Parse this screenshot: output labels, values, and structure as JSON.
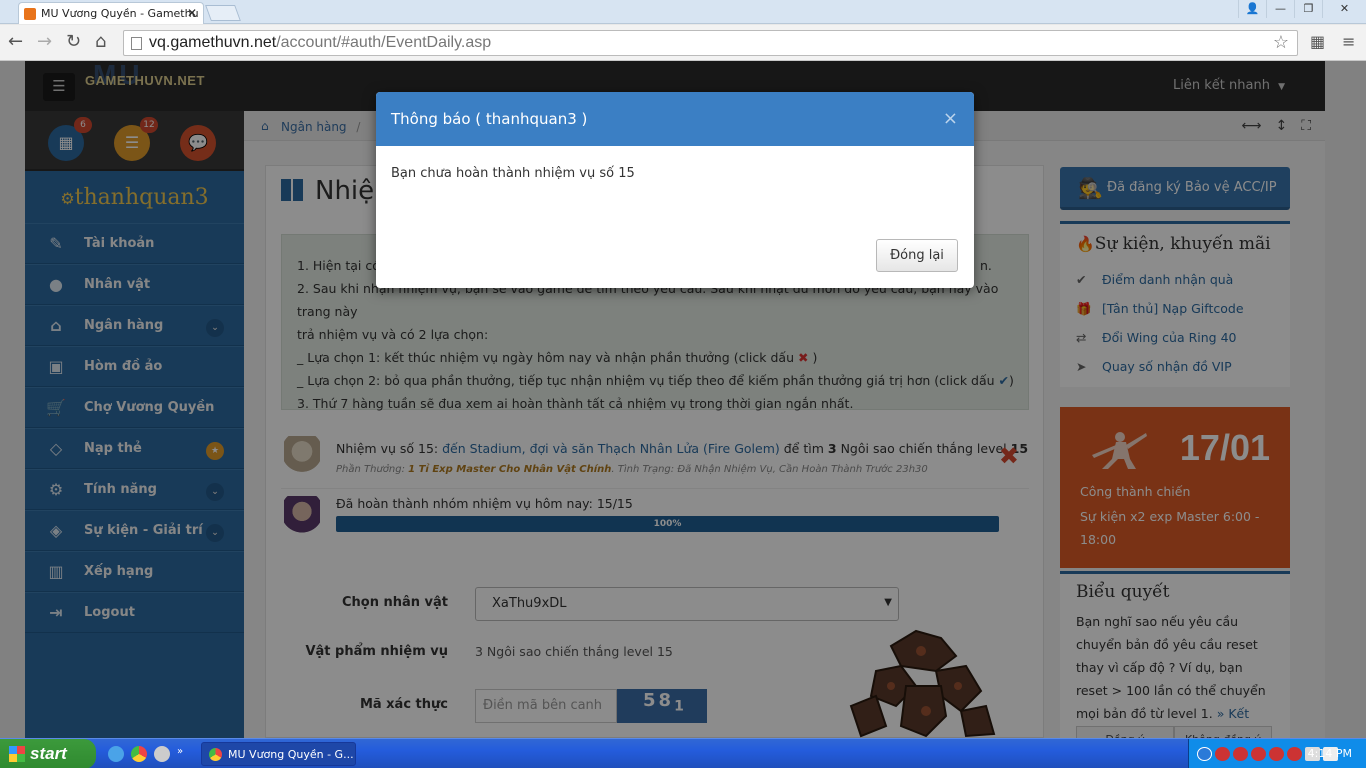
{
  "browser": {
    "tab_title": "MU Vương Quyền - Gamethu",
    "tab_close": "✕",
    "url_host": "vq.gamethuvn.net",
    "url_path": "/account/#auth/EventDaily.asp"
  },
  "site": {
    "logo_text": "GAMETHUVN.NET",
    "logo_mu": "MU",
    "quick_links": "Liên kết nhanh"
  },
  "sidebar": {
    "badges": {
      "calendar": "6",
      "list": "12"
    },
    "username": "thanhquan3",
    "items": [
      {
        "label": "Tài khoản",
        "icon": "edit-icon",
        "glyph": "✎"
      },
      {
        "label": "Nhân vật",
        "icon": "user-icon",
        "glyph": "●"
      },
      {
        "label": "Ngân hàng",
        "icon": "bank-icon",
        "glyph": "⌂"
      },
      {
        "label": "Hòm đồ ảo",
        "icon": "briefcase-icon",
        "glyph": "▣"
      },
      {
        "label": "Chợ Vương Quyền",
        "icon": "cart-icon",
        "glyph": "🛒"
      },
      {
        "label": "Nạp thẻ",
        "icon": "diamond-icon",
        "glyph": "◇"
      },
      {
        "label": "Tính năng",
        "icon": "cogs-icon",
        "glyph": "⚙"
      },
      {
        "label": "Sự kiện - Giải trí",
        "icon": "tag-icon",
        "glyph": "◈"
      },
      {
        "label": "Xếp hạng",
        "icon": "chart-icon",
        "glyph": "▥"
      },
      {
        "label": "Logout",
        "icon": "logout-icon",
        "glyph": "⇥"
      }
    ]
  },
  "breadcrumb": {
    "home": "Ngân hàng",
    "sep": "/"
  },
  "page": {
    "title": "Nhiệm",
    "info": {
      "line1": "1. Hiện tại có",
      "line1_end": "n.",
      "line2": "2. Sau khi nhận nhiệm vụ, bạn sẽ vào game để tìm theo yêu cầu. Sau khi nhặt đủ món đồ yêu cầu, bạn hãy vào trang này",
      "line3": "trả nhiệm vụ và có 2 lựa chọn:",
      "line4a": "_ Lựa chọn 1: kết thúc nhiệm vụ ngày hôm nay và nhận phần thưởng (click dấu",
      "line4b": ")",
      "line5a": "_ Lựa chọn 2: bỏ qua phần thưởng, tiếp tục nhận nhiệm vụ tiếp theo để kiếm phần thưởng giá trị hơn (click dấu",
      "line5b": ")",
      "line6": "3. Thứ 7 hàng tuần sẽ đua xem ai hoàn thành tất cả nhiệm vụ trong thời gian ngắn nhất.",
      "x_mark": "✖",
      "check_mark": "✔"
    },
    "task": {
      "prefix": "Nhiệm vụ số 15:",
      "link": "đến Stadium, đợi và săn Thạch Nhân Lửa (Fire Golem)",
      "find": "để tìm",
      "count": "3",
      "item": "Ngôi sao chiến thắng level",
      "level": "15",
      "reward_label": "Phần Thưởng:",
      "reward": "1 Tỉ Exp Master Cho Nhân Vật Chính",
      "status": ". Tình Trạng: Đã Nhận Nhiệm Vụ, Cần Hoàn Thành Trước 23h30",
      "delete": "✖"
    },
    "progress": {
      "label": "Đã hoàn thành nhóm nhiệm vụ hôm nay: 15/15",
      "value_text": "100%",
      "value": 100
    },
    "form": {
      "char_label": "Chọn nhân vật",
      "char_value": "XaThu9xDL",
      "item_label": "Vật phẩm nhiệm vụ",
      "item_value": "3 Ngôi sao chiến thắng level 15",
      "captcha_label": "Mã xác thực",
      "captcha_placeholder": "Điền mã bên canh",
      "captcha_text": "58",
      "captcha_sub": "1"
    }
  },
  "right": {
    "protect": "Đã đăng ký Bảo vệ ACC/IP",
    "events_title": "Sự kiện, khuyến mãi",
    "events": [
      {
        "label": "Điểm danh nhận quà",
        "glyph": "✔"
      },
      {
        "label": "[Tân thủ] Nạp Giftcode",
        "glyph": "🎁"
      },
      {
        "label": "Đổi Wing của Ring 40",
        "glyph": "⇄"
      },
      {
        "label": "Quay số nhận đồ VIP",
        "glyph": "➤"
      }
    ],
    "siege": {
      "date": "17/01",
      "title": "Công thành chiến",
      "desc": "Sự kiện x2 exp Master 6:00 - 18:00"
    },
    "poll": {
      "title": "Biểu quyết",
      "text": "Bạn nghĩ sao nếu yêu cầu chuyển bản đồ yêu cầu reset thay vì cấp độ ? Ví dụ, bạn reset > 100 lần có thể chuyển mọi bản đồ từ level 1.",
      "result": "» Kết quả",
      "agree": "Đồng ý",
      "disagree": "Không đồng ý"
    }
  },
  "modal": {
    "title": "Thông báo ( thanhquan3 )",
    "message": "Bạn chưa hoàn thành nhiệm vụ số 15",
    "close_label": "Đóng lại",
    "close_x": "×"
  },
  "taskbar": {
    "start": "start",
    "task": "MU Vương Quyền - G...",
    "clock": "4:14 PM",
    "chevron": "»"
  }
}
